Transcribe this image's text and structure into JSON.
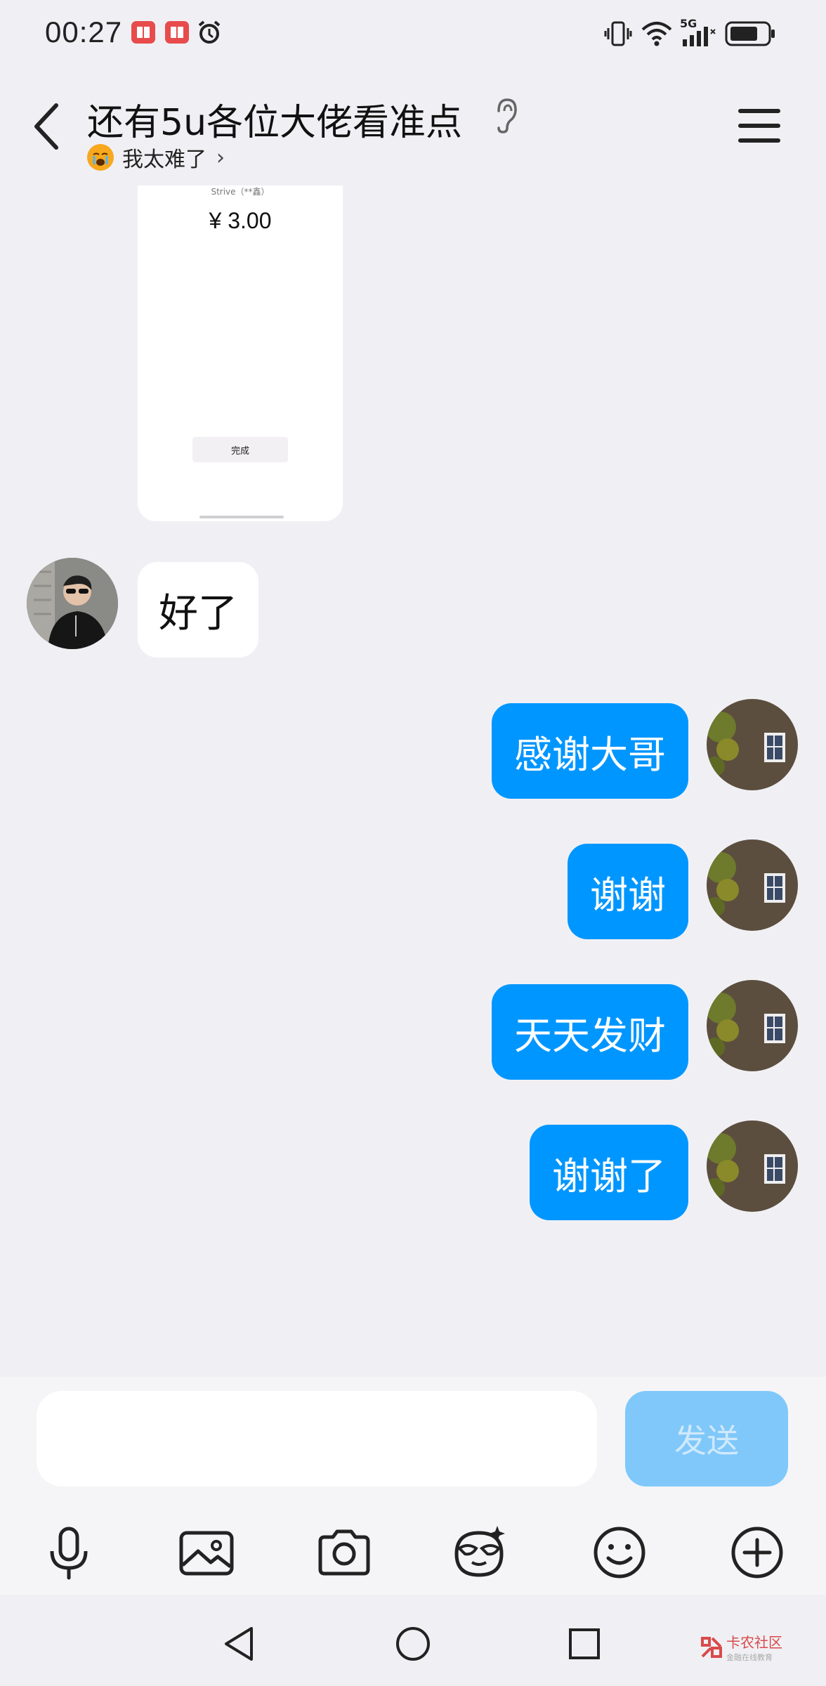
{
  "status_bar": {
    "time": "00:27",
    "icons": [
      "notification-app-icon",
      "notification-app-icon",
      "alarm-icon",
      "vibrate-icon",
      "wifi-icon",
      "signal-5g-icon",
      "battery-icon"
    ],
    "network_label": "5G"
  },
  "header": {
    "title": "还有5u各位大佬看准点",
    "subtitle": "我太难了",
    "subtitle_emoji": "crying-face-icon"
  },
  "image_message": {
    "payee": "Strive（**鑫）",
    "amount": "¥ 3.00",
    "done_label": "完成"
  },
  "messages": [
    {
      "direction": "incoming",
      "text": "好了"
    },
    {
      "direction": "outgoing",
      "text": "感谢大哥"
    },
    {
      "direction": "outgoing",
      "text": "谢谢"
    },
    {
      "direction": "outgoing",
      "text": "天天发财"
    },
    {
      "direction": "outgoing",
      "text": "谢谢了"
    }
  ],
  "composer": {
    "placeholder": "",
    "send_label": "发送",
    "send_color": "#80c8fa",
    "tools": [
      "microphone-icon",
      "image-icon",
      "camera-icon",
      "sticker-icon",
      "emoji-icon",
      "plus-icon"
    ]
  },
  "colors": {
    "outgoing_bubble": "#0096ff",
    "incoming_bubble": "#ffffff",
    "background": "#f0f0f4"
  },
  "watermark": {
    "brand": "卡农社区",
    "tagline": "金融在线教育"
  }
}
